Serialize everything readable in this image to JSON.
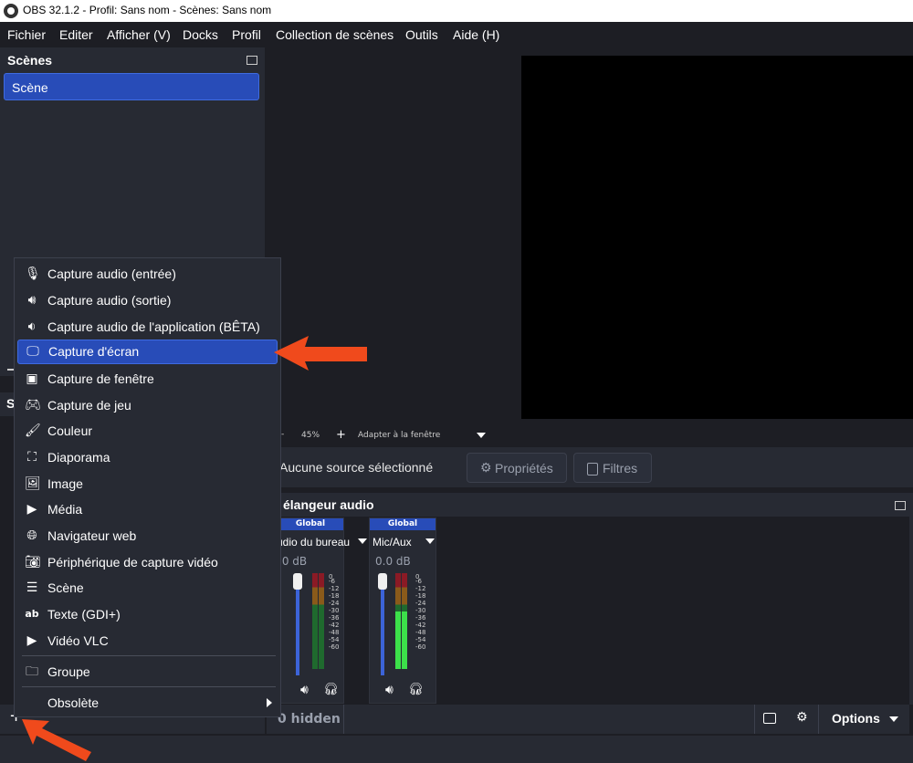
{
  "window": {
    "title": "OBS 32.1.2 - Profil: Sans nom - Scènes: Sans nom"
  },
  "menu": [
    "Fichier",
    "Editer",
    "Afficher (V)",
    "Docks",
    "Profil",
    "Collection de scènes",
    "Outils",
    "Aide (H)"
  ],
  "scenes": {
    "title": "Scènes",
    "items": [
      "Scène"
    ]
  },
  "sources_partial_title": "S",
  "zoom": {
    "minus": "-",
    "value": "45%",
    "plus": "+",
    "fit": "Adapter à la fenêtre"
  },
  "source_toolbar": {
    "no_source": "Aucune source sélectionné",
    "properties": "Propriétés",
    "filters": "Filtres"
  },
  "mixer": {
    "title": "élangeur audio",
    "channels": [
      {
        "head": "Global",
        "name": "udio du bureau",
        "db": ".0 dB"
      },
      {
        "head": "Global",
        "name": "Mic/Aux",
        "db": "0.0 dB"
      }
    ],
    "scale": [
      "0",
      "-6",
      "-12",
      "-18",
      "-24",
      "-30",
      "-36",
      "-42",
      "-48",
      "-54",
      "-60"
    ]
  },
  "bottom": {
    "hidden": "0 hidden",
    "options": "Options"
  },
  "context_menu": {
    "items": [
      {
        "label": "Capture audio (entrée)",
        "icon": "microphone-icon"
      },
      {
        "label": "Capture audio (sortie)",
        "icon": "speaker-icon"
      },
      {
        "label": "Capture audio de l'application (BÊTA)",
        "icon": "app-audio-icon"
      },
      {
        "label": "Capture d'écran",
        "icon": "monitor-icon",
        "selected": true
      },
      {
        "label": "Capture de fenêtre",
        "icon": "window-icon"
      },
      {
        "label": "Capture de jeu",
        "icon": "gamepad-icon"
      },
      {
        "label": "Couleur",
        "icon": "brush-icon"
      },
      {
        "label": "Diaporama",
        "icon": "slideshow-icon"
      },
      {
        "label": "Image",
        "icon": "image-icon"
      },
      {
        "label": "Média",
        "icon": "play-icon"
      },
      {
        "label": "Navigateur web",
        "icon": "globe-icon"
      },
      {
        "label": "Périphérique de capture vidéo",
        "icon": "camera-icon"
      },
      {
        "label": "Scène",
        "icon": "list-icon"
      },
      {
        "label": "Texte (GDI+)",
        "icon": "text-icon"
      },
      {
        "label": "Vidéo VLC",
        "icon": "play-icon"
      }
    ],
    "group": "Groupe",
    "obsolete": "Obsolète"
  },
  "colors": {
    "accent": "#284cb8",
    "panel": "#272a33",
    "bg": "#1d1e24",
    "arrow": "#f04a1c"
  }
}
